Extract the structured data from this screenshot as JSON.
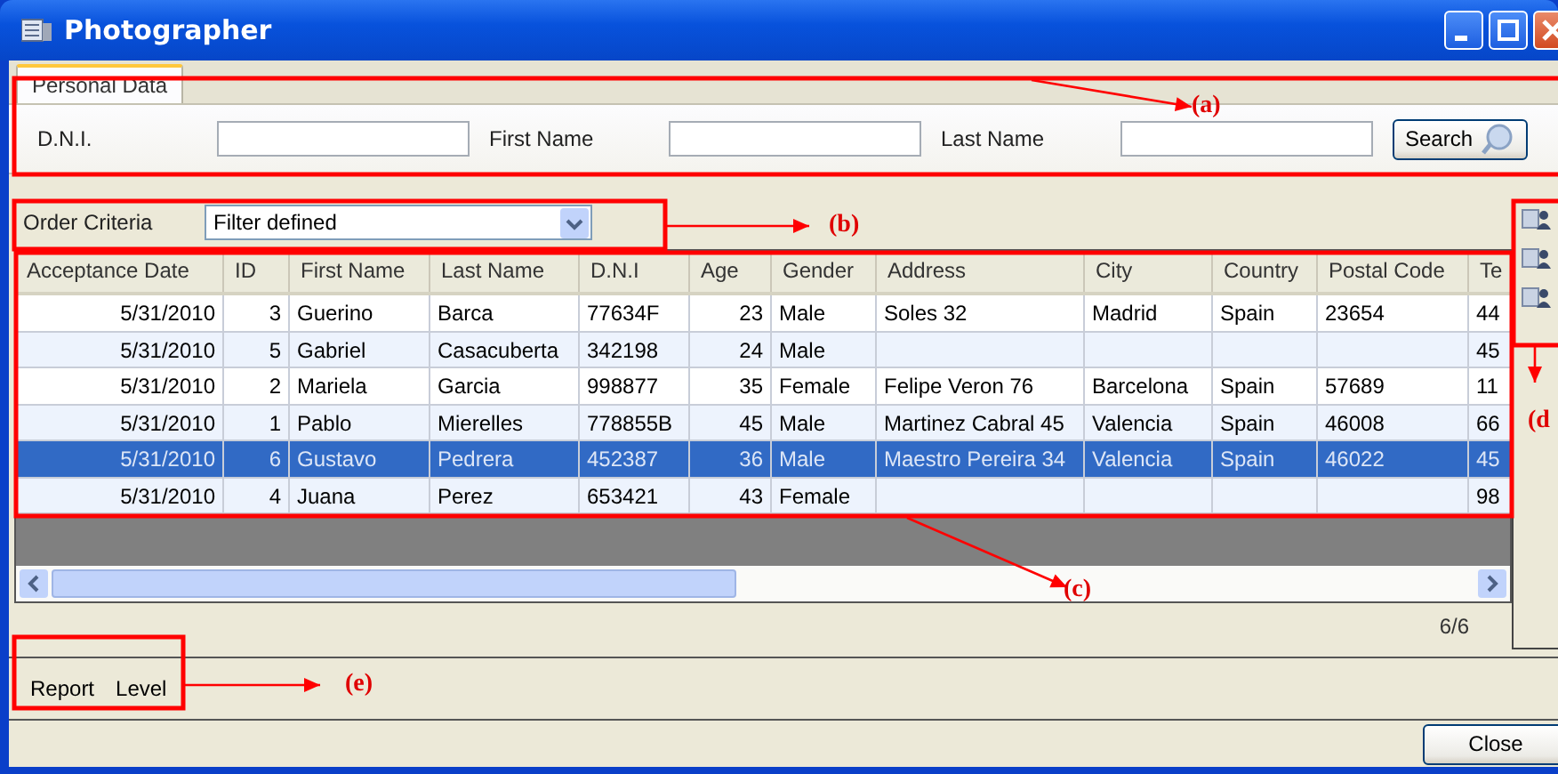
{
  "window": {
    "title": "Photographer"
  },
  "tabs": [
    {
      "label": "Personal Data",
      "selected": true
    }
  ],
  "search_fields": [
    {
      "label": "D.N.I."
    },
    {
      "label": "First Name"
    },
    {
      "label": "Last Name"
    }
  ],
  "search_button": "Search",
  "order_criteria": {
    "label": "Order Criteria",
    "value": "Filter defined"
  },
  "table": {
    "columns": [
      {
        "label": "Acceptance Date",
        "kind": "number"
      },
      {
        "label": "ID",
        "kind": "number"
      },
      {
        "label": "First Name",
        "kind": "text"
      },
      {
        "label": "Last Name",
        "kind": "text"
      },
      {
        "label": "D.N.I",
        "kind": "text"
      },
      {
        "label": "Age",
        "kind": "number"
      },
      {
        "label": "Gender",
        "kind": "text"
      },
      {
        "label": "Address",
        "kind": "text"
      },
      {
        "label": "City",
        "kind": "text"
      },
      {
        "label": "Country",
        "kind": "text"
      },
      {
        "label": "Postal Code",
        "kind": "text"
      },
      {
        "label": "Te",
        "kind": "text"
      }
    ],
    "rows": [
      {
        "selected": false,
        "cells": [
          "5/31/2010",
          "3",
          "Guerino",
          "Barca",
          "77634F",
          "23",
          "Male",
          "Soles 32",
          "Madrid",
          "Spain",
          "23654",
          "44"
        ]
      },
      {
        "selected": false,
        "cells": [
          "5/31/2010",
          "5",
          "Gabriel",
          "Casacuberta",
          "342198",
          "24",
          "Male",
          "",
          "",
          "",
          "",
          "45"
        ]
      },
      {
        "selected": false,
        "cells": [
          "5/31/2010",
          "2",
          "Mariela",
          "Garcia",
          "998877",
          "35",
          "Female",
          "Felipe Veron 76",
          "Barcelona",
          "Spain",
          "57689",
          "11"
        ]
      },
      {
        "selected": false,
        "cells": [
          "5/31/2010",
          "1",
          "Pablo",
          "Mierelles",
          "778855B",
          "45",
          "Male",
          "Martinez Cabral 45",
          "Valencia",
          "Spain",
          "46008",
          "66"
        ]
      },
      {
        "selected": true,
        "cells": [
          "5/31/2010",
          "6",
          "Gustavo",
          "Pedrera",
          "452387",
          "36",
          "Male",
          "Maestro Pereira 34",
          "Valencia",
          "Spain",
          "46022",
          "45"
        ]
      },
      {
        "selected": false,
        "cells": [
          "5/31/2010",
          "4",
          "Juana",
          "Perez",
          "653421",
          "43",
          "Female",
          "",
          "",
          "",
          "",
          "98"
        ]
      }
    ]
  },
  "record_count": "6/6",
  "report_labels": [
    "Report",
    "Level"
  ],
  "close_button": "Close",
  "annotations": [
    {
      "label": "(a)"
    },
    {
      "label": "(b)"
    },
    {
      "label": "(c)"
    },
    {
      "label": "(d"
    },
    {
      "label": "(e)"
    }
  ]
}
